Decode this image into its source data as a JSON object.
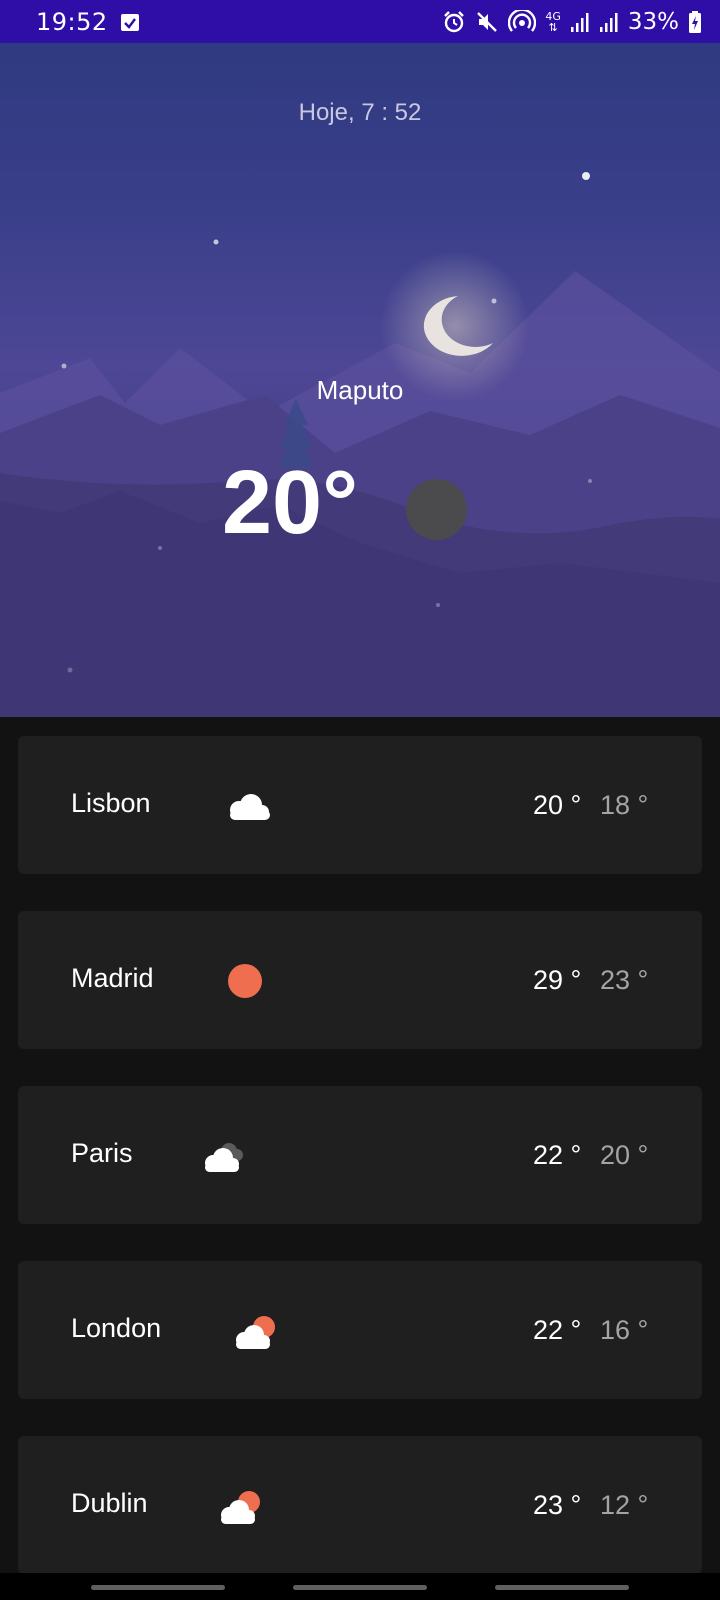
{
  "status_bar": {
    "time": "19:52",
    "battery": "33%",
    "network": "4G",
    "icons": [
      "calendar-check-icon",
      "alarm-icon",
      "mute-icon",
      "hotspot-icon",
      "signal-icon",
      "signal-icon",
      "battery-charging-icon"
    ]
  },
  "hero": {
    "date_time": "Hoje, 7 : 52",
    "city": "Maputo",
    "temperature": "20°",
    "weather_icon": "night-icon"
  },
  "cities": [
    {
      "name": "Lisbon",
      "icon": "cloud-icon",
      "high": "20 °",
      "low": "18 °"
    },
    {
      "name": "Madrid",
      "icon": "sun-icon",
      "high": "29 °",
      "low": "23 °"
    },
    {
      "name": "Paris",
      "icon": "clouds-icon",
      "high": "22 °",
      "low": "20 °"
    },
    {
      "name": "London",
      "icon": "partly-cloudy-icon",
      "high": "22 °",
      "low": "16 °"
    },
    {
      "name": "Dublin",
      "icon": "partly-cloudy-icon",
      "high": "23 °",
      "low": "12 °"
    }
  ],
  "colors": {
    "status_bar": "#2f0ea8",
    "background": "#121212",
    "card": "#1f1f1f",
    "sun": "#ee6e4f",
    "cloud": "#ffffff"
  }
}
